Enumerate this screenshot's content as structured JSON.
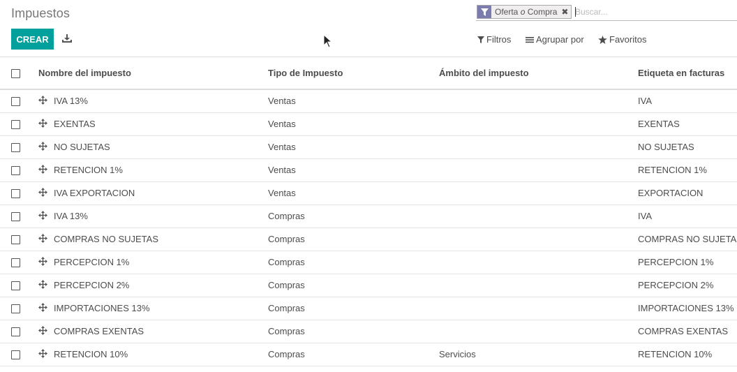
{
  "page": {
    "title": "Impuestos"
  },
  "toolbar": {
    "create_label": "CREAR",
    "download_icon": "download-icon"
  },
  "search": {
    "facet_value_1": "Oferta",
    "facet_separator": "o",
    "facet_value_2": "Compra",
    "placeholder": "Buscar..."
  },
  "filters": {
    "filters_label": "Filtros",
    "group_label": "Agrupar por",
    "favorites_label": "Favoritos"
  },
  "colors": {
    "accent": "#00a09d",
    "facet": "#7c7bad"
  },
  "table": {
    "headers": [
      "Nombre del impuesto",
      "Tipo de Impuesto",
      "Ámbito del impuesto",
      "Etiqueta en facturas"
    ],
    "rows": [
      {
        "name": "IVA 13%",
        "type": "Ventas",
        "scope": "",
        "label": "IVA"
      },
      {
        "name": "EXENTAS",
        "type": "Ventas",
        "scope": "",
        "label": "EXENTAS"
      },
      {
        "name": "NO SUJETAS",
        "type": "Ventas",
        "scope": "",
        "label": "NO SUJETAS"
      },
      {
        "name": "RETENCION 1%",
        "type": "Ventas",
        "scope": "",
        "label": "RETENCION 1%"
      },
      {
        "name": "IVA EXPORTACION",
        "type": "Ventas",
        "scope": "",
        "label": "EXPORTACION"
      },
      {
        "name": "IVA 13%",
        "type": "Compras",
        "scope": "",
        "label": "IVA"
      },
      {
        "name": "COMPRAS NO SUJETAS",
        "type": "Compras",
        "scope": "",
        "label": "COMPRAS NO SUJETAS"
      },
      {
        "name": "PERCEPCION 1%",
        "type": "Compras",
        "scope": "",
        "label": "PERCEPCION 1%"
      },
      {
        "name": "PERCEPCION 2%",
        "type": "Compras",
        "scope": "",
        "label": "PERCEPCION 2%"
      },
      {
        "name": "IMPORTACIONES 13%",
        "type": "Compras",
        "scope": "",
        "label": "IMPORTACIONES 13%"
      },
      {
        "name": "COMPRAS EXENTAS",
        "type": "Compras",
        "scope": "",
        "label": "COMPRAS EXENTAS"
      },
      {
        "name": "RETENCION 10%",
        "type": "Compras",
        "scope": "Servicios",
        "label": "RETENCION 10%"
      }
    ]
  }
}
